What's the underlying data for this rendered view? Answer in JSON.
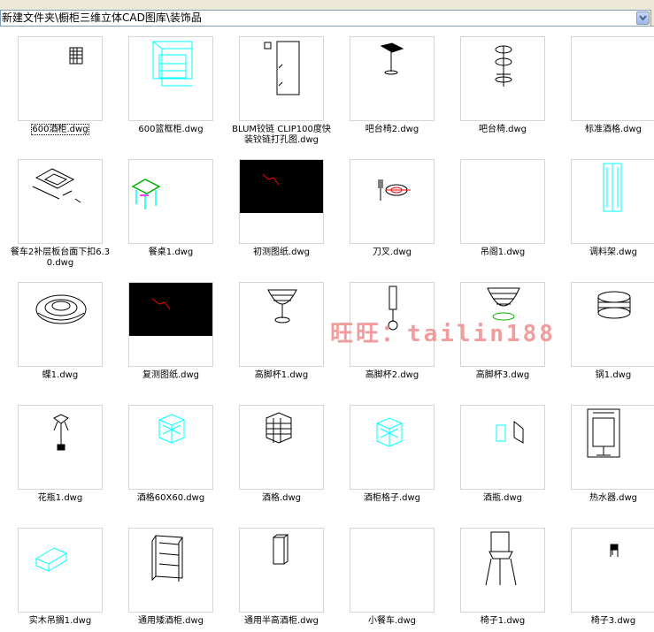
{
  "address_bar": {
    "path": "新建文件夹\\橱柜三维立体CAD图库\\装饰品"
  },
  "watermark": "旺旺：tailin188",
  "files": [
    {
      "name": "600酒柜.dwg",
      "icon": "cad-thumbnail",
      "selected": true
    },
    {
      "name": "600篮框柜.dwg",
      "icon": "cad-thumbnail"
    },
    {
      "name": "BLUM铰链 CLIP100度快装铰链打孔图.dwg",
      "icon": "cad-thumbnail"
    },
    {
      "name": "吧台椅2.dwg",
      "icon": "cad-thumbnail"
    },
    {
      "name": "吧台椅.dwg",
      "icon": "cad-thumbnail"
    },
    {
      "name": "标准酒格.dwg",
      "icon": "cad-thumbnail"
    },
    {
      "name": "餐车2补层板台面下扣6.30.dwg",
      "icon": "cad-thumbnail"
    },
    {
      "name": "餐桌1.dwg",
      "icon": "cad-thumbnail"
    },
    {
      "name": "初测图纸.dwg",
      "icon": "cad-thumbnail"
    },
    {
      "name": "刀叉.dwg",
      "icon": "cad-thumbnail"
    },
    {
      "name": "吊阁1.dwg",
      "icon": "cad-thumbnail"
    },
    {
      "name": "调料架.dwg",
      "icon": "cad-thumbnail"
    },
    {
      "name": "蝶1.dwg",
      "icon": "cad-thumbnail"
    },
    {
      "name": "复测图纸.dwg",
      "icon": "cad-thumbnail"
    },
    {
      "name": "高脚杯1.dwg",
      "icon": "cad-thumbnail"
    },
    {
      "name": "高脚杯2.dwg",
      "icon": "cad-thumbnail"
    },
    {
      "name": "高脚杯3.dwg",
      "icon": "cad-thumbnail"
    },
    {
      "name": "锅1.dwg",
      "icon": "cad-thumbnail"
    },
    {
      "name": "花瓶1.dwg",
      "icon": "cad-thumbnail"
    },
    {
      "name": "酒格60X60.dwg",
      "icon": "cad-thumbnail"
    },
    {
      "name": "酒格.dwg",
      "icon": "cad-thumbnail"
    },
    {
      "name": "酒柜格子.dwg",
      "icon": "cad-thumbnail"
    },
    {
      "name": "酒瓶.dwg",
      "icon": "cad-thumbnail"
    },
    {
      "name": "热水器.dwg",
      "icon": "cad-thumbnail"
    },
    {
      "name": "实木吊搁1.dwg",
      "icon": "cad-thumbnail"
    },
    {
      "name": "通用矮酒柜.dwg",
      "icon": "cad-thumbnail"
    },
    {
      "name": "通用半高酒柜.dwg",
      "icon": "cad-thumbnail"
    },
    {
      "name": "小餐车.dwg",
      "icon": "cad-thumbnail"
    },
    {
      "name": "椅子1.dwg",
      "icon": "cad-thumbnail"
    },
    {
      "name": "椅子3.dwg",
      "icon": "cad-thumbnail"
    }
  ],
  "colors": {
    "cyan_line": "#00ffff",
    "black_line": "#000000",
    "red_line": "#ff0000",
    "green_line": "#00b000"
  }
}
